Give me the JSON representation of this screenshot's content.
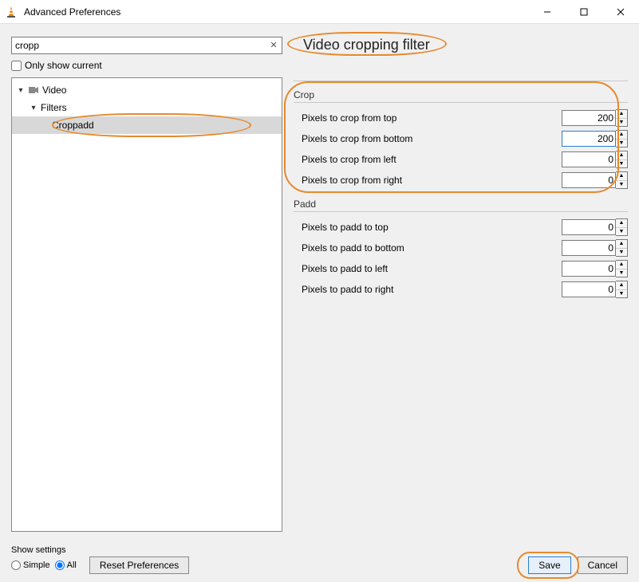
{
  "window": {
    "title": "Advanced Preferences"
  },
  "search": {
    "value": "cropp",
    "clear_glyph": "✕"
  },
  "only_show_current_label": "Only show current",
  "heading": "Video cropping filter",
  "tree": {
    "video_label": "Video",
    "filters_label": "Filters",
    "croppadd_label": "Croppadd"
  },
  "crop": {
    "title": "Crop",
    "rows": [
      {
        "label": "Pixels to crop from top",
        "value": "200"
      },
      {
        "label": "Pixels to crop from bottom",
        "value": "200"
      },
      {
        "label": "Pixels to crop from left",
        "value": "0"
      },
      {
        "label": "Pixels to crop from right",
        "value": "0"
      }
    ]
  },
  "padd": {
    "title": "Padd",
    "rows": [
      {
        "label": "Pixels to padd to top",
        "value": "0"
      },
      {
        "label": "Pixels to padd to bottom",
        "value": "0"
      },
      {
        "label": "Pixels to padd to left",
        "value": "0"
      },
      {
        "label": "Pixels to padd to right",
        "value": "0"
      }
    ]
  },
  "footer": {
    "show_settings_label": "Show settings",
    "simple_label": "Simple",
    "all_label": "All",
    "reset_label": "Reset Preferences",
    "save_label": "Save",
    "cancel_label": "Cancel"
  }
}
